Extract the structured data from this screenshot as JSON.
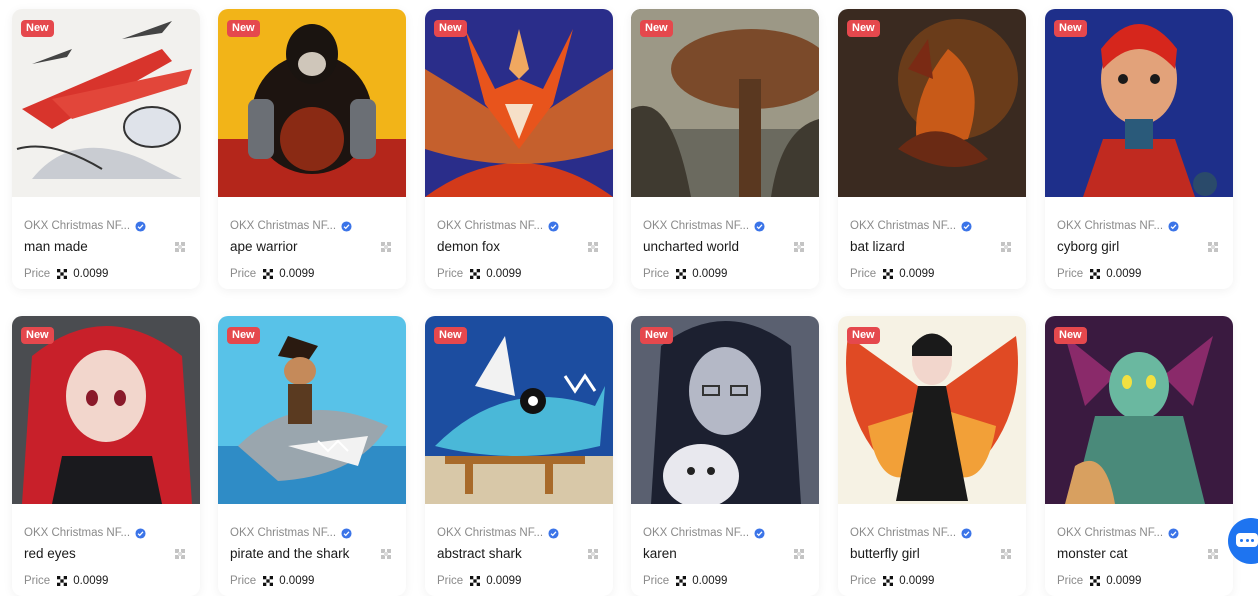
{
  "badge_text": "New",
  "price_label": "Price",
  "icons": {
    "verified": "verified-badge-icon",
    "favorite": "favorite-icon",
    "currency": "okt-token-icon",
    "chat": "chat-icon"
  },
  "colors": {
    "badge": "#e5484d",
    "verified": "#3b74e8",
    "chat": "#1e74f0"
  },
  "cards": [
    {
      "collection": "OKX Christmas NF...",
      "name": "man made",
      "price": "0.0099",
      "art": "plane"
    },
    {
      "collection": "OKX Christmas NF...",
      "name": "ape warrior",
      "price": "0.0099",
      "art": "ape"
    },
    {
      "collection": "OKX Christmas NF...",
      "name": "demon fox",
      "price": "0.0099",
      "art": "fox"
    },
    {
      "collection": "OKX Christmas NF...",
      "name": "uncharted world",
      "price": "0.0099",
      "art": "world"
    },
    {
      "collection": "OKX Christmas NF...",
      "name": "bat lizard",
      "price": "0.0099",
      "art": "lizard"
    },
    {
      "collection": "OKX Christmas NF...",
      "name": "cyborg girl",
      "price": "0.0099",
      "art": "cyborg"
    },
    {
      "collection": "OKX Christmas NF...",
      "name": "red eyes",
      "price": "0.0099",
      "art": "redeyes"
    },
    {
      "collection": "OKX Christmas NF...",
      "name": "pirate and the shark",
      "price": "0.0099",
      "art": "pirate"
    },
    {
      "collection": "OKX Christmas NF...",
      "name": "abstract shark",
      "price": "0.0099",
      "art": "abshark"
    },
    {
      "collection": "OKX Christmas NF...",
      "name": "karen",
      "price": "0.0099",
      "art": "karen"
    },
    {
      "collection": "OKX Christmas NF...",
      "name": "butterfly girl",
      "price": "0.0099",
      "art": "butterfly"
    },
    {
      "collection": "OKX Christmas NF...",
      "name": "monster cat",
      "price": "0.0099",
      "art": "monster"
    }
  ]
}
